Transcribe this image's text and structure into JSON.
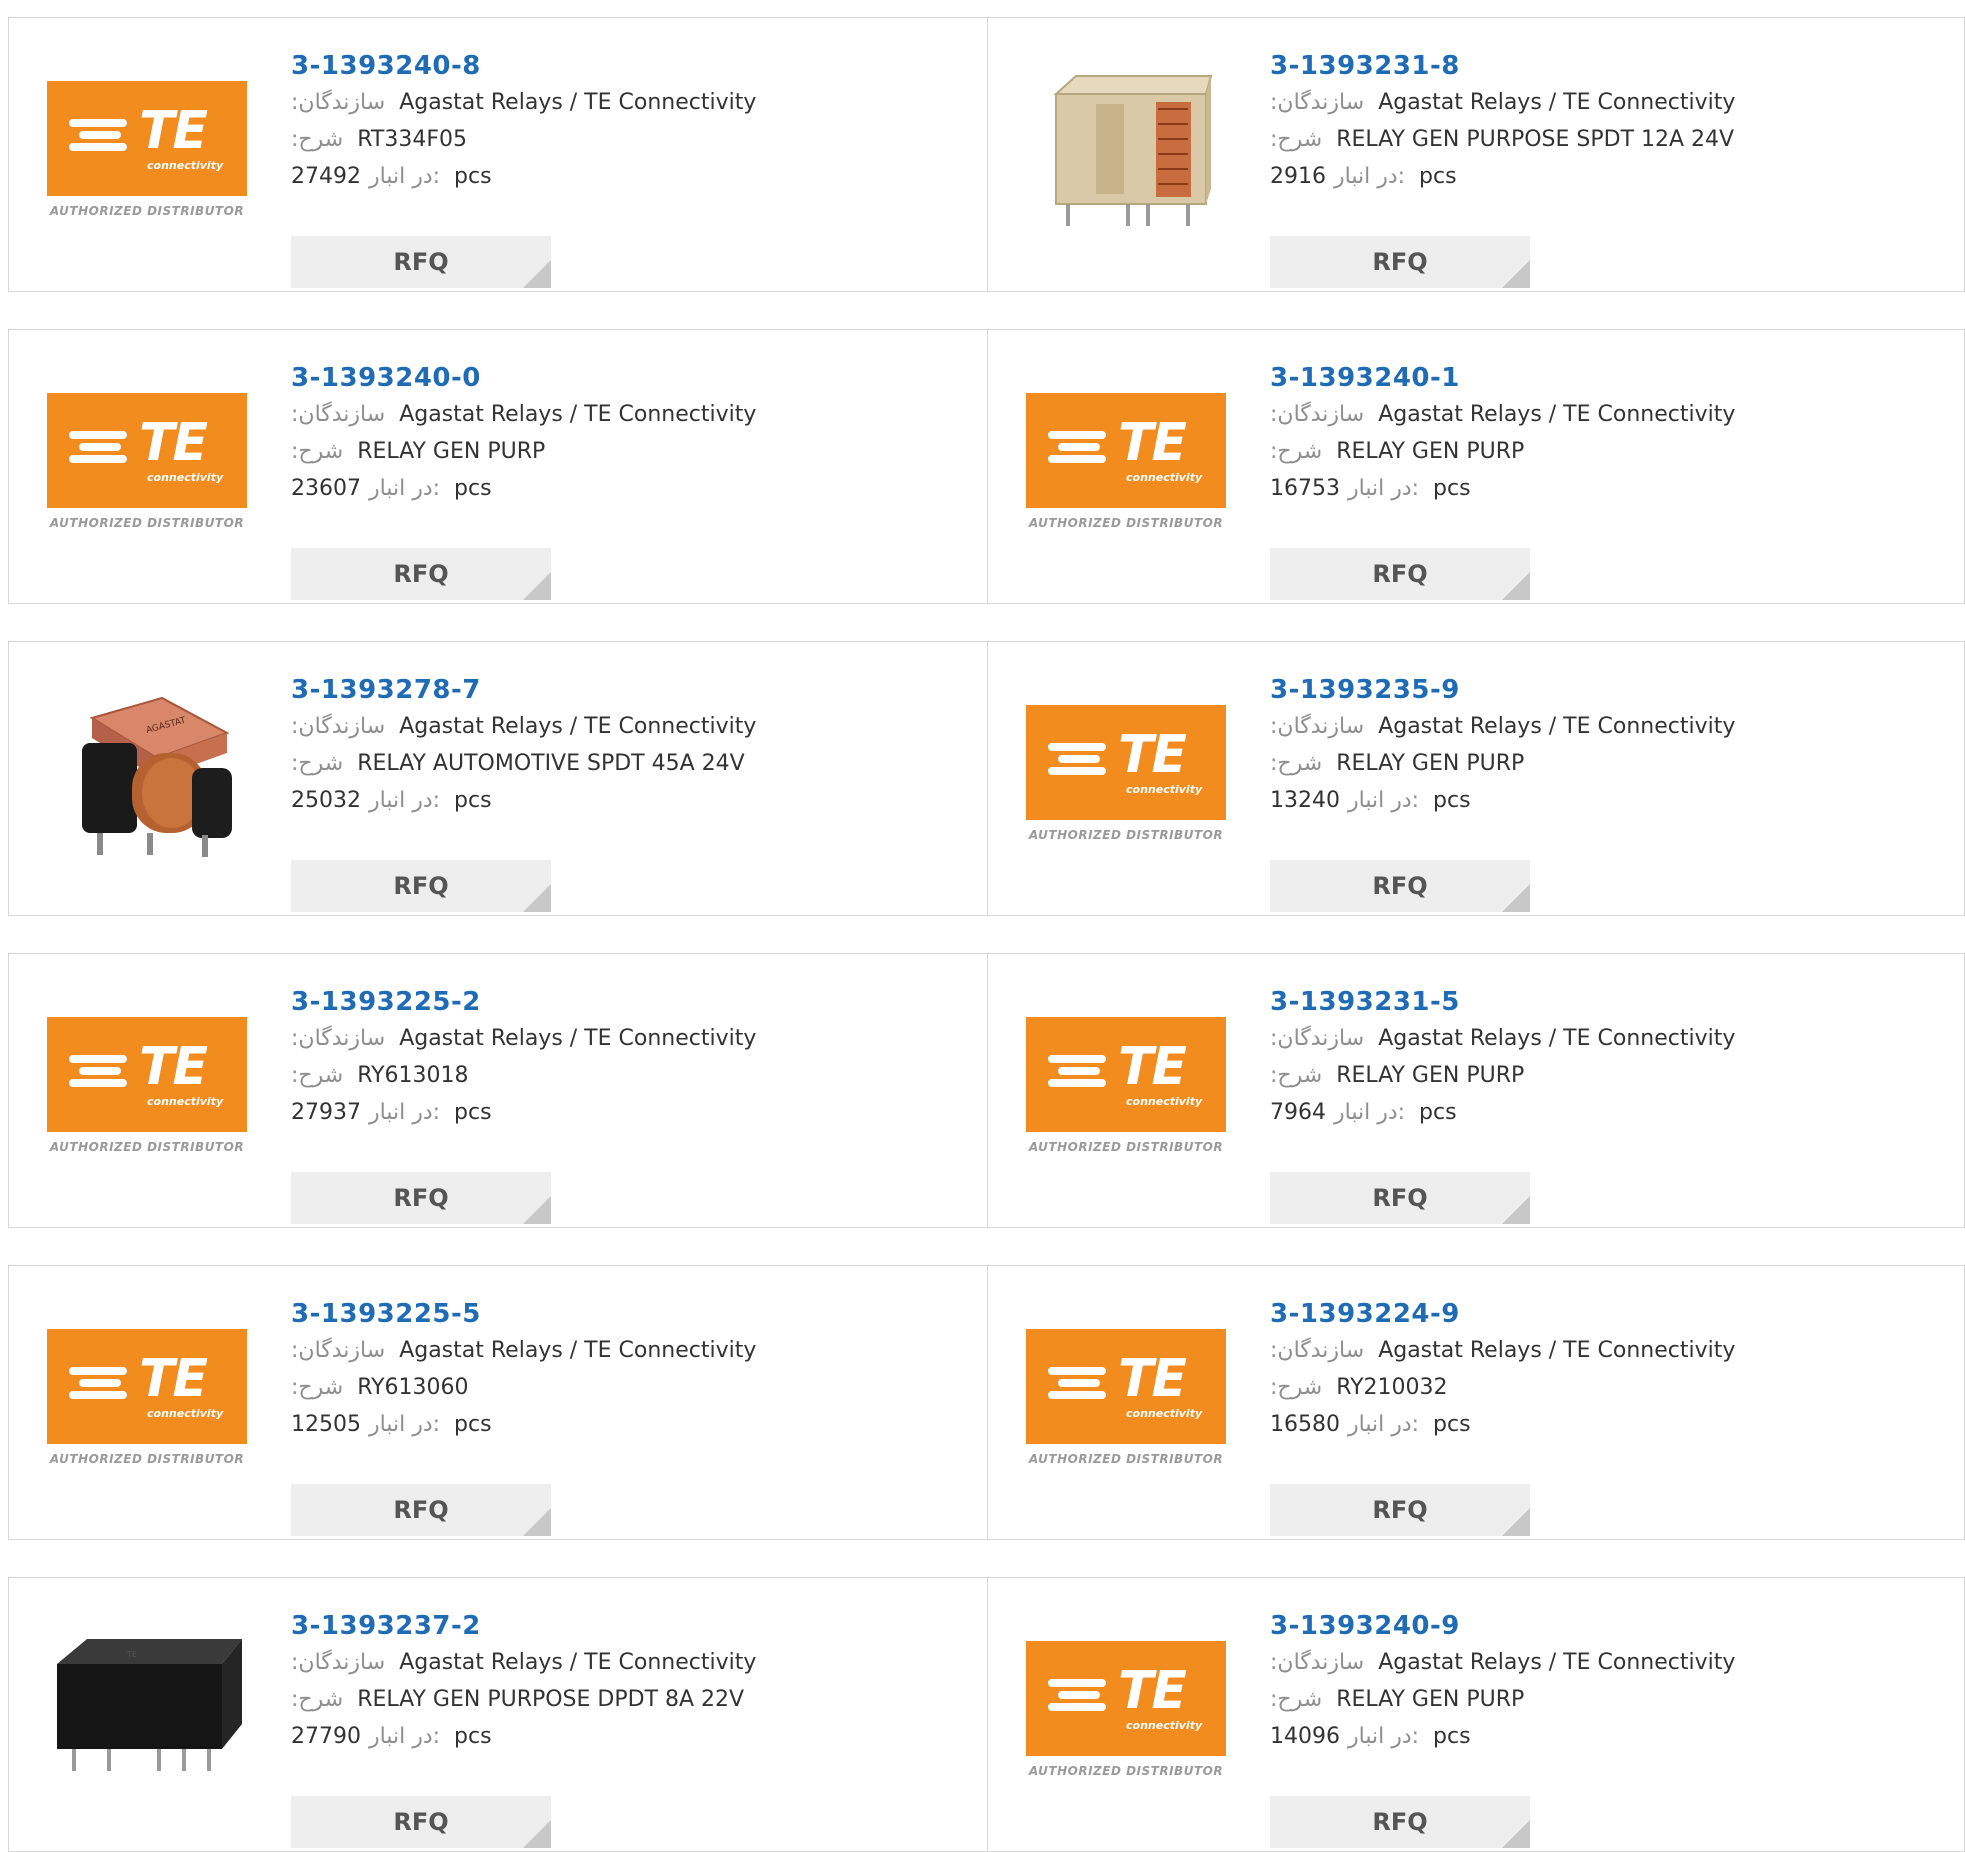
{
  "labels": {
    "manufacturer": ":سازندگان",
    "description": ":شرح",
    "stock": "در انبار:",
    "unit": "pcs",
    "rfq": "RFQ"
  },
  "logo": {
    "brand": "TE",
    "tagline": "connectivity",
    "authorized": "AUTHORIZED DISTRIBUTOR",
    "color": "#f28c1e"
  },
  "colors": {
    "part_link": "#1f6cb5",
    "rfq_bg": "#eeeeee",
    "border": "#d6d6d6"
  },
  "products": [
    {
      "part": "3-1393240-8",
      "manufacturer": "Agastat Relays / TE Connectivity",
      "description": "RT334F05",
      "stock": "27492",
      "image": "te-logo"
    },
    {
      "part": "3-1393231-8",
      "manufacturer": "Agastat Relays / TE Connectivity",
      "description": "RELAY GEN PURPOSE SPDT 12A 24V",
      "stock": "2916",
      "image": "clear-relay"
    },
    {
      "part": "3-1393240-0",
      "manufacturer": "Agastat Relays / TE Connectivity",
      "description": "RELAY GEN PURP",
      "stock": "23607",
      "image": "te-logo"
    },
    {
      "part": "3-1393240-1",
      "manufacturer": "Agastat Relays / TE Connectivity",
      "description": "RELAY GEN PURP",
      "stock": "16753",
      "image": "te-logo"
    },
    {
      "part": "3-1393278-7",
      "manufacturer": "Agastat Relays / TE Connectivity",
      "description": "RELAY AUTOMOTIVE SPDT 45A 24V",
      "stock": "25032",
      "image": "automotive-relay"
    },
    {
      "part": "3-1393235-9",
      "manufacturer": "Agastat Relays / TE Connectivity",
      "description": "RELAY GEN PURP",
      "stock": "13240",
      "image": "te-logo"
    },
    {
      "part": "3-1393225-2",
      "manufacturer": "Agastat Relays / TE Connectivity",
      "description": "RY613018",
      "stock": "27937",
      "image": "te-logo"
    },
    {
      "part": "3-1393231-5",
      "manufacturer": "Agastat Relays / TE Connectivity",
      "description": "RELAY GEN PURP",
      "stock": "7964",
      "image": "te-logo"
    },
    {
      "part": "3-1393225-5",
      "manufacturer": "Agastat Relays / TE Connectivity",
      "description": "RY613060",
      "stock": "12505",
      "image": "te-logo"
    },
    {
      "part": "3-1393224-9",
      "manufacturer": "Agastat Relays / TE Connectivity",
      "description": "RY210032",
      "stock": "16580",
      "image": "te-logo"
    },
    {
      "part": "3-1393237-2",
      "manufacturer": "Agastat Relays / TE Connectivity",
      "description": "RELAY GEN PURPOSE DPDT 8A 22V",
      "stock": "27790",
      "image": "black-relay"
    },
    {
      "part": "3-1393240-9",
      "manufacturer": "Agastat Relays / TE Connectivity",
      "description": "RELAY GEN PURP",
      "stock": "14096",
      "image": "te-logo"
    }
  ]
}
